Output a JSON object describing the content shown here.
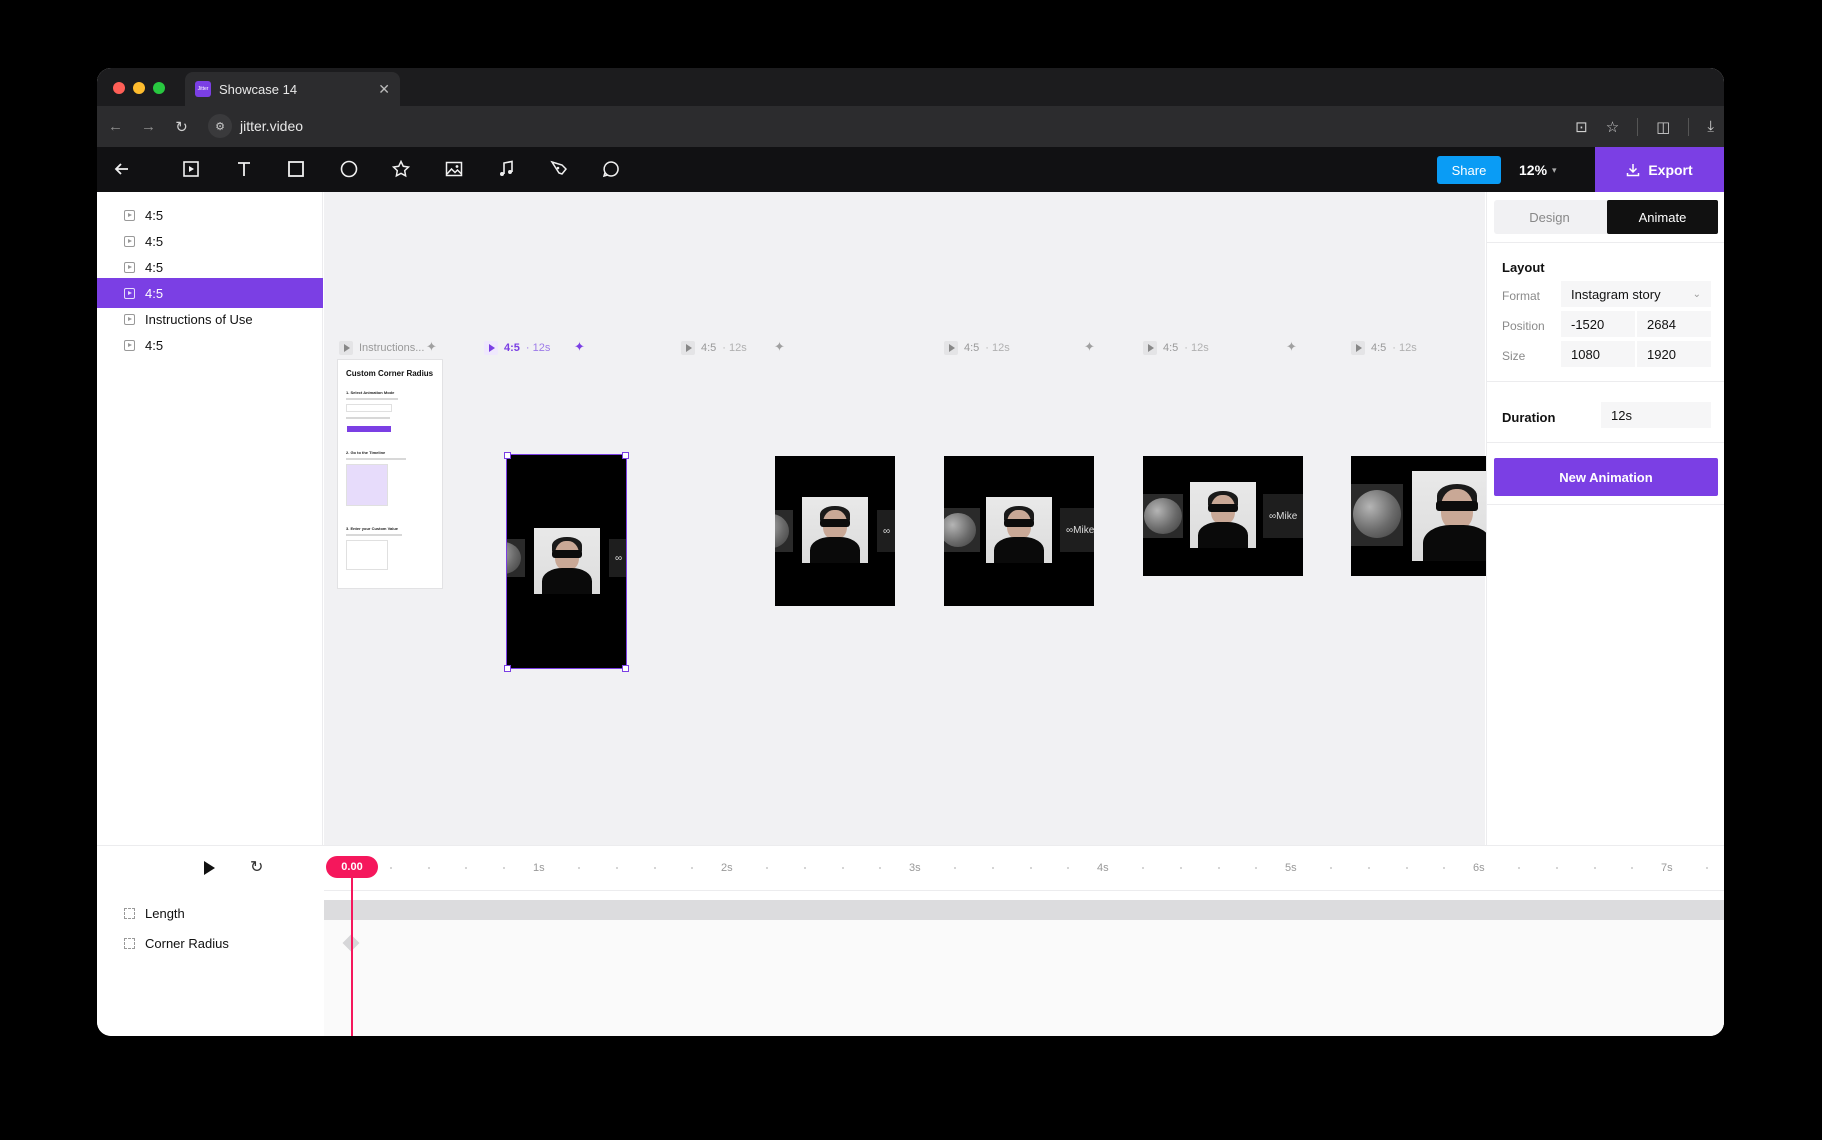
{
  "browser": {
    "tab_title": "Showcase 14",
    "favicon_text": "Jitter",
    "url": "jitter.video",
    "traffic_colors": [
      "#ff5f57",
      "#febc2e",
      "#28c840"
    ]
  },
  "toolbar": {
    "share_label": "Share",
    "zoom_label": "12%",
    "export_label": "Export",
    "tools": [
      "back-arrow-icon",
      "artboard-icon",
      "text-icon",
      "rectangle-icon",
      "ellipse-icon",
      "star-icon",
      "image-icon",
      "music-icon",
      "pen-icon",
      "comment-icon"
    ]
  },
  "layers": [
    {
      "label": "4:5",
      "selected": false
    },
    {
      "label": "4:5",
      "selected": false
    },
    {
      "label": "4:5",
      "selected": false
    },
    {
      "label": "4:5",
      "selected": true
    },
    {
      "label": "Instructions of Use",
      "selected": false
    },
    {
      "label": "4:5",
      "selected": false
    }
  ],
  "canvas": {
    "frames": [
      {
        "name": "Instructions...",
        "duration": ""
      },
      {
        "name": "4:5",
        "duration": "· 12s",
        "selected": true
      },
      {
        "name": "4:5",
        "duration": "· 12s"
      },
      {
        "name": "4:5",
        "duration": "· 12s"
      },
      {
        "name": "4:5",
        "duration": "· 12s"
      },
      {
        "name": "4:5",
        "duration": "· 12s"
      }
    ],
    "instructions": {
      "title": "Custom Corner Radius",
      "step1": "1. Select Animation Mode",
      "step2": "2. Go to the Timeline",
      "step3": "3. Enter your Custom Value"
    },
    "logo_text": "Mike"
  },
  "panel": {
    "tab_design": "Design",
    "tab_animate": "Animate",
    "layout_title": "Layout",
    "format_label": "Format",
    "format_value": "Instagram story",
    "position_label": "Position",
    "position_x": "-1520",
    "position_y": "2684",
    "size_label": "Size",
    "size_w": "1080",
    "size_h": "1920",
    "duration_label": "Duration",
    "duration_value": "12s",
    "new_animation_label": "New Animation"
  },
  "timeline": {
    "playhead": "0.00",
    "ticks": [
      "1s",
      "2s",
      "3s",
      "4s",
      "5s",
      "6s",
      "7s"
    ],
    "rows": [
      "Length",
      "Corner Radius"
    ]
  },
  "colors": {
    "accent": "#7b3fe4",
    "share": "#0a9cf5",
    "playhead": "#f5175c"
  }
}
